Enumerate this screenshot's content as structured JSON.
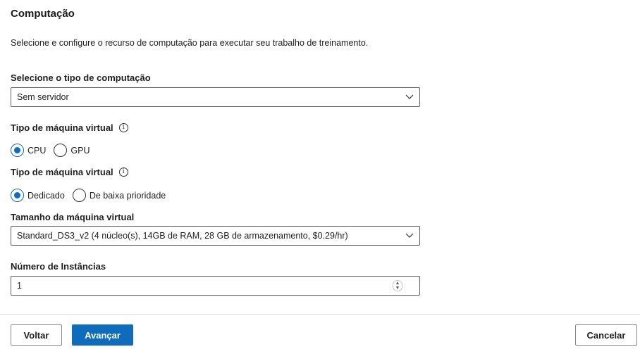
{
  "title": "Computação",
  "description": "Selecione e configure o recurso de computação para executar seu trabalho de treinamento.",
  "compute_type": {
    "label": "Selecione o tipo de computação",
    "value": "Sem servidor"
  },
  "vm_type": {
    "label": "Tipo de máquina virtual",
    "options": [
      "CPU",
      "GPU"
    ],
    "selected": "CPU"
  },
  "vm_priority": {
    "label": "Tipo de máquina virtual",
    "options": [
      "Dedicado",
      "De baixa prioridade"
    ],
    "selected": "Dedicado"
  },
  "vm_size": {
    "label": "Tamanho da máquina virtual",
    "value": "Standard_DS3_v2 (4 núcleo(s), 14GB de RAM, 28 GB de armazenamento, $0.29/hr)"
  },
  "instances": {
    "label": "Número de Instâncias",
    "value": "1"
  },
  "footer": {
    "back_label": "Voltar",
    "next_label": "Avançar",
    "cancel_label": "Cancelar"
  },
  "colors": {
    "accent": "#0f6cbd",
    "border": "#605e5c"
  },
  "icons": {
    "info": "info-icon",
    "chevron": "chevron-down-icon",
    "spinner": "spin-button-icon"
  }
}
